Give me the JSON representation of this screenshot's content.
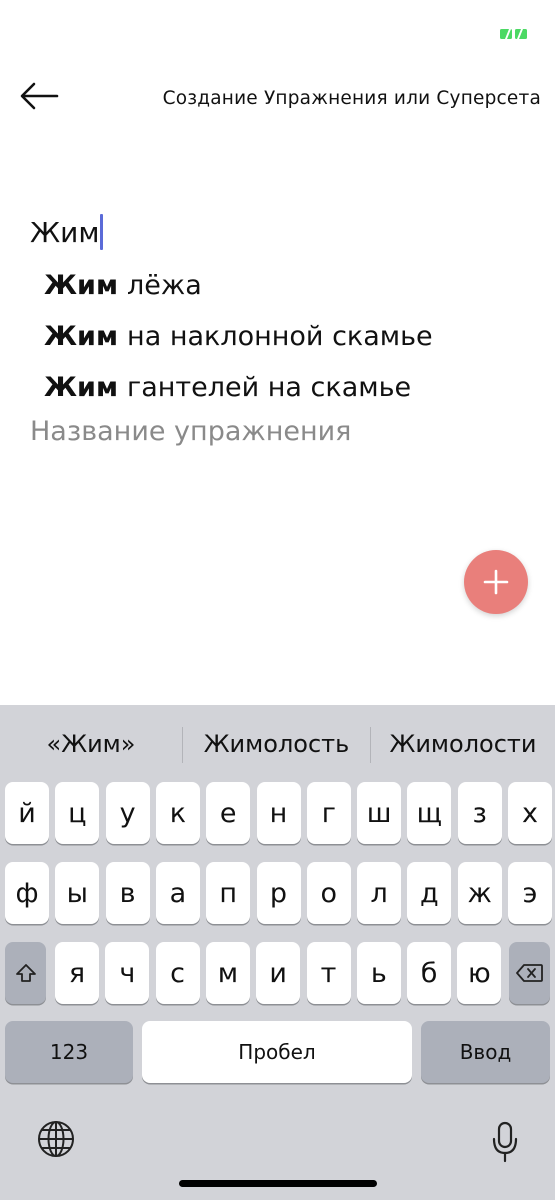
{
  "header": {
    "title": "Создание Упражнения или Суперсета"
  },
  "exercise_input": {
    "typed_value": "Жим",
    "placeholder": "Название упражнения"
  },
  "suggestions": [
    {
      "match": "Жим",
      "rest": "лёжа"
    },
    {
      "match": "Жим",
      "rest": "на наклонной скамье"
    },
    {
      "match": "Жим",
      "rest": "гантелей на скамье"
    }
  ],
  "keyboard": {
    "predictive": [
      "«Жим»",
      "Жимолость",
      "Жимолости"
    ],
    "row1": [
      "й",
      "ц",
      "у",
      "к",
      "е",
      "н",
      "г",
      "ш",
      "щ",
      "з",
      "х"
    ],
    "row2": [
      "ф",
      "ы",
      "в",
      "а",
      "п",
      "р",
      "о",
      "л",
      "д",
      "ж",
      "э"
    ],
    "row3": [
      "я",
      "ч",
      "с",
      "м",
      "и",
      "т",
      "ь",
      "б",
      "ю"
    ],
    "numbers_label": "123",
    "space_label": "Пробел",
    "enter_label": "Ввод"
  },
  "colors": {
    "fab": "#e97f7b",
    "cursor": "#5b6bd8",
    "battery": "#4cd964",
    "keyboard_bg": "#d2d3d8"
  }
}
